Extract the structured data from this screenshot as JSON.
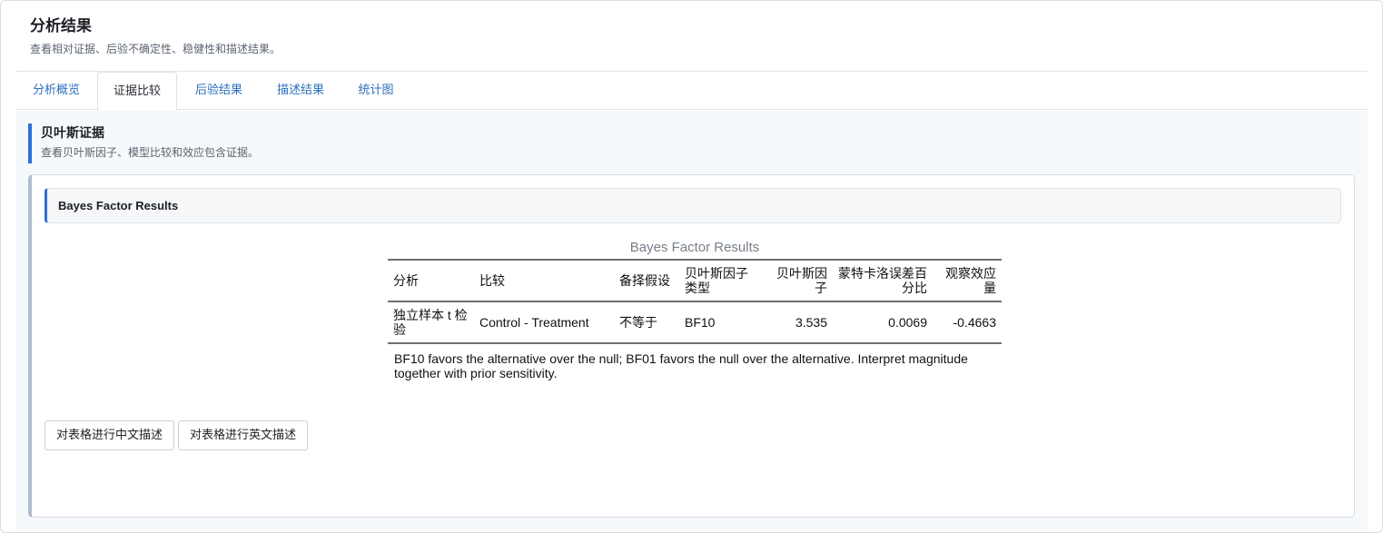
{
  "header": {
    "title": "分析结果",
    "subtitle": "查看相对证据、后验不确定性、稳健性和描述结果。"
  },
  "tabs": [
    {
      "label": "分析概览",
      "active": false
    },
    {
      "label": "证据比较",
      "active": true
    },
    {
      "label": "后验结果",
      "active": false
    },
    {
      "label": "描述结果",
      "active": false
    },
    {
      "label": "统计图",
      "active": false
    }
  ],
  "section": {
    "title": "贝叶斯证据",
    "subtitle": "查看贝叶斯因子、模型比较和效应包含证据。"
  },
  "card": {
    "title": "Bayes Factor Results"
  },
  "table": {
    "caption": "Bayes Factor Results",
    "columns": [
      "分析",
      "比较",
      "备择假设",
      "贝叶斯因子类型",
      "贝叶斯因子",
      "蒙特卡洛误差百分比",
      "观察效应量"
    ],
    "rows": [
      [
        "独立样本 t 检验",
        "Control - Treatment",
        "不等于",
        "BF10",
        "3.535",
        "0.0069",
        "-0.4663"
      ]
    ],
    "note": "BF10 favors the alternative over the null; BF01 favors the null over the alternative. Interpret magnitude together with prior sensitivity."
  },
  "buttons": {
    "describe_cn": "对表格进行中文描述",
    "describe_en": "对表格进行英文描述"
  },
  "colors": {
    "accent": "#2f6fd6",
    "link": "#2c6fbd",
    "card_border_left": "#aebcd1"
  }
}
